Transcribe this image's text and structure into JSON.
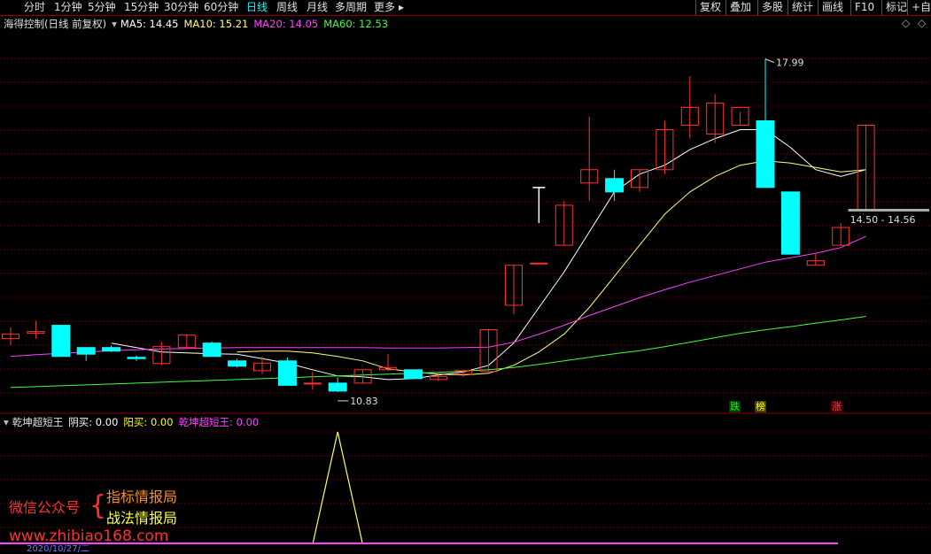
{
  "toolbar": {
    "left": [
      {
        "label": "分时",
        "active": false
      },
      {
        "label": "1分钟",
        "active": false
      },
      {
        "label": "5分钟",
        "active": false
      },
      {
        "label": "15分钟",
        "active": false
      },
      {
        "label": "30分钟",
        "active": false
      },
      {
        "label": "60分钟",
        "active": false
      },
      {
        "label": "日线",
        "active": true
      },
      {
        "label": "周线",
        "active": false
      },
      {
        "label": "月线",
        "active": false
      },
      {
        "label": "多周期",
        "active": false
      },
      {
        "label": "更多",
        "active": false
      }
    ],
    "more_arrow": "▸",
    "right": [
      "复权",
      "叠加",
      "多股",
      "统计",
      "画线",
      "F10",
      "标记",
      "+自"
    ]
  },
  "main_header": {
    "title": "海得控制(日线 前复权)",
    "ma": [
      {
        "label": "MA5: 14.45",
        "color": "#ffffff"
      },
      {
        "label": "MA10: 15.21",
        "color": "#ffff80"
      },
      {
        "label": "MA20: 14.05",
        "color": "#ff40ff"
      },
      {
        "label": "MA60: 12.53",
        "color": "#40ff40"
      }
    ]
  },
  "sub_header": {
    "title": "乾坤超短王",
    "items": [
      {
        "label": "阴买: 0.00",
        "color": "#ffffff"
      },
      {
        "label": "阳买: 0.00",
        "color": "#ffff00"
      },
      {
        "label": "乾坤超短王: 0.00",
        "color": "#ff40ff"
      }
    ]
  },
  "chart_data": {
    "type": "candlestick",
    "price_range": [
      10.2,
      18.6
    ],
    "candles": [
      {
        "o": 11.7,
        "h": 11.95,
        "l": 11.55,
        "c": 11.8
      },
      {
        "o": 11.82,
        "h": 12.1,
        "l": 11.7,
        "c": 11.86
      },
      {
        "o": 12.0,
        "h": 12.0,
        "l": 11.3,
        "c": 11.3
      },
      {
        "o": 11.5,
        "h": 11.5,
        "l": 11.2,
        "c": 11.35
      },
      {
        "o": 11.5,
        "h": 11.55,
        "l": 11.4,
        "c": 11.42
      },
      {
        "o": 11.28,
        "h": 11.32,
        "l": 11.2,
        "c": 11.25
      },
      {
        "o": 11.14,
        "h": 11.62,
        "l": 11.1,
        "c": 11.52
      },
      {
        "o": 11.5,
        "h": 11.8,
        "l": 11.5,
        "c": 11.78
      },
      {
        "o": 11.6,
        "h": 11.63,
        "l": 11.3,
        "c": 11.3
      },
      {
        "o": 11.2,
        "h": 11.25,
        "l": 11.05,
        "c": 11.08
      },
      {
        "o": 10.98,
        "h": 11.3,
        "l": 10.9,
        "c": 11.15
      },
      {
        "o": 11.2,
        "h": 11.28,
        "l": 10.65,
        "c": 10.65
      },
      {
        "o": 10.68,
        "h": 10.95,
        "l": 10.55,
        "c": 10.7
      },
      {
        "o": 10.7,
        "h": 10.83,
        "l": 10.5,
        "c": 10.52
      },
      {
        "o": 10.7,
        "h": 11.0,
        "l": 10.7,
        "c": 11.0
      },
      {
        "o": 11.0,
        "h": 11.35,
        "l": 10.98,
        "c": 11.05
      },
      {
        "o": 11.0,
        "h": 11.0,
        "l": 10.8,
        "c": 10.8
      },
      {
        "o": 10.78,
        "h": 10.9,
        "l": 10.75,
        "c": 10.85
      },
      {
        "o": 10.9,
        "h": 11.0,
        "l": 10.85,
        "c": 10.98
      },
      {
        "o": 10.96,
        "h": 11.92,
        "l": 10.96,
        "c": 11.9
      },
      {
        "o": 12.45,
        "h": 13.35,
        "l": 12.25,
        "c": 13.35
      },
      {
        "o": 13.4,
        "h": 13.4,
        "l": 13.4,
        "c": 13.4
      },
      {
        "o": 13.8,
        "h": 14.8,
        "l": 13.8,
        "c": 14.7
      },
      {
        "o": 15.2,
        "h": 16.7,
        "l": 14.8,
        "c": 15.5
      },
      {
        "o": 15.3,
        "h": 15.5,
        "l": 14.8,
        "c": 15.0
      },
      {
        "o": 15.1,
        "h": 15.5,
        "l": 15.0,
        "c": 15.5
      },
      {
        "o": 15.5,
        "h": 16.6,
        "l": 15.4,
        "c": 16.4
      },
      {
        "o": 16.5,
        "h": 17.6,
        "l": 16.2,
        "c": 16.9
      },
      {
        "o": 16.3,
        "h": 17.2,
        "l": 16.1,
        "c": 17.0
      },
      {
        "o": 16.5,
        "h": 16.8,
        "l": 16.5,
        "c": 16.9
      },
      {
        "o": 16.6,
        "h": 17.99,
        "l": 15.1,
        "c": 15.1
      },
      {
        "o": 15.0,
        "h": 15.0,
        "l": 13.6,
        "c": 13.6
      },
      {
        "o": 13.35,
        "h": 13.6,
        "l": 13.35,
        "c": 13.45
      },
      {
        "o": 13.8,
        "h": 14.3,
        "l": 13.8,
        "c": 14.2
      },
      {
        "o": 14.6,
        "h": 16.5,
        "l": 14.6,
        "c": 16.5
      }
    ],
    "ma": [
      {
        "name": "MA5",
        "color": "#ffffff",
        "values": [
          null,
          null,
          null,
          null,
          11.6,
          11.5,
          11.4,
          11.38,
          11.36,
          11.35,
          11.25,
          11.15,
          11.0,
          10.86,
          10.84,
          10.78,
          10.8,
          10.88,
          10.95,
          11.1,
          11.6,
          12.4,
          13.2,
          14.1,
          15.0,
          15.4,
          15.6,
          15.95,
          16.2,
          16.4,
          16.4,
          16.0,
          15.5,
          15.35,
          15.5
        ]
      },
      {
        "name": "MA10",
        "color": "#ffff80",
        "values": [
          null,
          null,
          null,
          null,
          null,
          null,
          null,
          null,
          null,
          11.4,
          11.42,
          11.42,
          11.38,
          11.3,
          11.2,
          11.02,
          10.95,
          10.9,
          10.88,
          10.92,
          11.1,
          11.4,
          11.8,
          12.4,
          13.1,
          13.8,
          14.5,
          15.0,
          15.35,
          15.6,
          15.7,
          15.65,
          15.55,
          15.45,
          15.5
        ]
      },
      {
        "name": "MA20",
        "color": "#ff40ff",
        "values": [
          11.3,
          11.34,
          11.37,
          11.4,
          11.43,
          11.45,
          11.47,
          11.48,
          11.49,
          11.5,
          11.5,
          11.5,
          11.5,
          11.5,
          11.5,
          11.49,
          11.49,
          11.49,
          11.5,
          11.51,
          11.62,
          11.8,
          12.0,
          12.22,
          12.42,
          12.62,
          12.8,
          12.97,
          13.12,
          13.27,
          13.42,
          13.52,
          13.62,
          13.75,
          14.0
        ]
      },
      {
        "name": "MA60",
        "color": "#40ff40",
        "values": [
          10.6,
          10.62,
          10.64,
          10.66,
          10.68,
          10.7,
          10.72,
          10.74,
          10.76,
          10.78,
          10.8,
          10.82,
          10.84,
          10.86,
          10.88,
          10.9,
          10.92,
          10.94,
          10.97,
          11.0,
          11.05,
          11.12,
          11.2,
          11.28,
          11.36,
          11.43,
          11.52,
          11.62,
          11.72,
          11.82,
          11.9,
          11.97,
          12.05,
          12.12,
          12.2
        ]
      }
    ],
    "annotations": {
      "high": "17.99",
      "low": "10.83",
      "range": "14.50 - 14.56"
    },
    "markers": [
      {
        "label": "跌",
        "color": "#00ff00",
        "bg": "#004000"
      },
      {
        "label": "榜",
        "color": "#ffff00",
        "bg": "#404000"
      },
      {
        "label": "涨",
        "color": "#ff4040",
        "bg": "#400000"
      }
    ],
    "indicator": {
      "name": "乾坤超短王",
      "spike_value": 1
    }
  },
  "watermark": {
    "wechat": "微信公众号",
    "line1": "指标情报局",
    "line2": "战法情报局",
    "url": "www.zhibiao168.com"
  },
  "footer_date": "2020/10/27/二"
}
